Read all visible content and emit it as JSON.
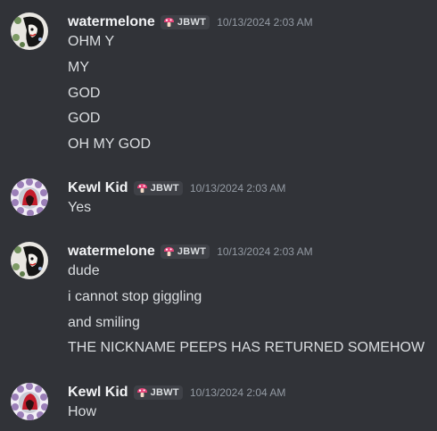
{
  "colors": {
    "background": "#313338",
    "username": "#f2f3f5",
    "message_text": "#dbdee1",
    "timestamp": "#949ba4",
    "tag_background": "#3f4147",
    "tag_icon": "#e8447a"
  },
  "messages": [
    {
      "username": "watermelone",
      "tag": "JBWT",
      "tag_icon": "mushroom-icon",
      "avatar": "avatar-watermelone",
      "timestamp": "10/13/2024 2:03 AM",
      "lines": [
        "OHM Y",
        "MY",
        "GOD",
        "GOD",
        "OH MY GOD"
      ]
    },
    {
      "username": "Kewl Kid",
      "tag": "JBWT",
      "tag_icon": "mushroom-icon",
      "avatar": "avatar-kewl-kid",
      "timestamp": "10/13/2024 2:03 AM",
      "lines": [
        "Yes"
      ]
    },
    {
      "username": "watermelone",
      "tag": "JBWT",
      "tag_icon": "mushroom-icon",
      "avatar": "avatar-watermelone",
      "timestamp": "10/13/2024 2:03 AM",
      "lines": [
        "dude",
        "i cannot stop giggling",
        "and smiling",
        "THE NICKNAME PEEPS HAS RETURNED SOMEHOW"
      ]
    },
    {
      "username": "Kewl Kid",
      "tag": "JBWT",
      "tag_icon": "mushroom-icon",
      "avatar": "avatar-kewl-kid",
      "timestamp": "10/13/2024 2:04 AM",
      "lines": [
        "How"
      ]
    }
  ]
}
